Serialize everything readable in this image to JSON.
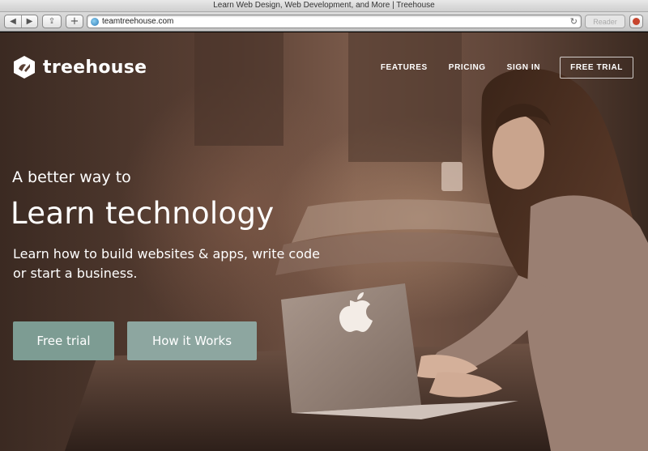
{
  "browser": {
    "window_title": "Learn Web Design, Web Development, and More | Treehouse",
    "url": "teamtreehouse.com",
    "reader_label": "Reader",
    "back_glyph": "◀",
    "forward_glyph": "▶",
    "share_glyph": "⇪",
    "new_tab_glyph": "+",
    "reload_glyph": "↻"
  },
  "site": {
    "brand": "treehouse",
    "nav": {
      "features": "FEATURES",
      "pricing": "PRICING",
      "sign_in": "SIGN IN",
      "free_trial": "FREE TRIAL"
    },
    "hero": {
      "kicker": "A better way to",
      "headline": "Learn technology",
      "subtext": "Learn how to build websites & apps, write code or start a business.",
      "primary_cta": "Free trial",
      "secondary_cta": "How it Works"
    }
  },
  "colors": {
    "primary_cta": "#7d9c93",
    "secondary_cta": "#8da6a0",
    "hero_tint": "#5a4034"
  },
  "icons": {
    "back": "back-arrow-icon",
    "forward": "forward-arrow-icon",
    "share": "share-icon",
    "new_tab": "plus-icon",
    "site": "globe-icon",
    "reload": "reload-icon",
    "downloads": "downloads-icon",
    "logo": "treehouse-logo-icon",
    "laptop_logo": "apple-logo-icon"
  }
}
